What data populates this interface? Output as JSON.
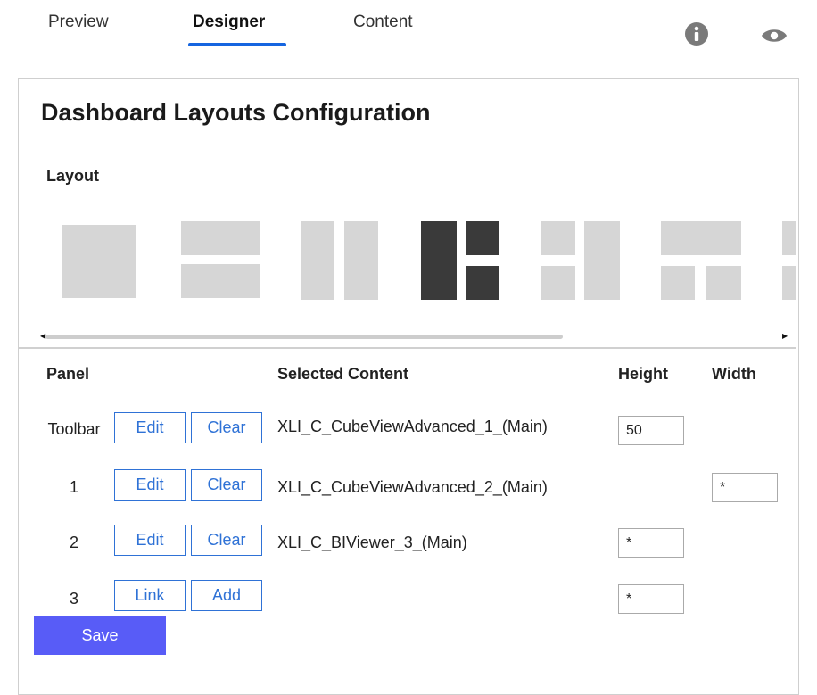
{
  "tabs": [
    {
      "label": "Preview",
      "active": false
    },
    {
      "label": "Designer",
      "active": true
    },
    {
      "label": "Content",
      "active": false
    }
  ],
  "header_icons": [
    "info-icon",
    "eye-icon"
  ],
  "page": {
    "title": "Dashboard Layouts Configuration",
    "layout_label": "Layout"
  },
  "layouts": {
    "selected_index": 3,
    "options": [
      "single",
      "two-rows",
      "two-columns",
      "left-column-right-two-rows",
      "left-two-rows-right-column",
      "top-row-bottom-two-columns",
      "partial-next"
    ]
  },
  "table": {
    "headers": {
      "panel": "Panel",
      "content": "Selected Content",
      "height": "Height",
      "width": "Width"
    },
    "rows": [
      {
        "panel": "Toolbar",
        "btn1": "Edit",
        "btn2": "Clear",
        "content": "XLI_C_CubeViewAdvanced_1_(Main)",
        "height": "50",
        "width": null
      },
      {
        "panel": "1",
        "btn1": "Edit",
        "btn2": "Clear",
        "content": "XLI_C_CubeViewAdvanced_2_(Main)",
        "height": null,
        "width": "*"
      },
      {
        "panel": "2",
        "btn1": "Edit",
        "btn2": "Clear",
        "content": "XLI_C_BIViewer_3_(Main)",
        "height": "*",
        "width": null
      },
      {
        "panel": "3",
        "btn1": "Link",
        "btn2": "Add",
        "content": "",
        "height": "*",
        "width": null
      }
    ]
  },
  "actions": {
    "save_label": "Save"
  },
  "colors": {
    "accent": "#1565e0",
    "button_border": "#2f72d6",
    "save_bg": "#585cf7",
    "selected_layout": "#3a3a3a",
    "layout_block": "#d6d6d6"
  }
}
